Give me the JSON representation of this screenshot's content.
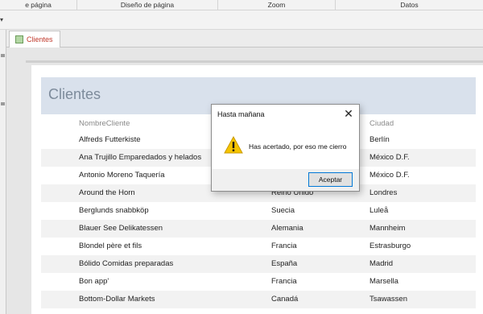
{
  "ribbon": {
    "groups": [
      {
        "label": "e página"
      },
      {
        "label": "Diseño de página"
      },
      {
        "label": "Zoom"
      },
      {
        "label": "Datos"
      }
    ]
  },
  "tabs": {
    "active_label": "Clientes"
  },
  "report": {
    "title": "Clientes",
    "columns": {
      "name": "NombreCliente",
      "city": "Ciudad"
    },
    "rows": [
      {
        "name": "Alfreds Futterkiste",
        "country": "",
        "city": "Berlín"
      },
      {
        "name": "Ana Trujillo Emparedados y helados",
        "country": "",
        "city": "México D.F."
      },
      {
        "name": "Antonio Moreno Taquería",
        "country": "",
        "city": "México D.F."
      },
      {
        "name": "Around the Horn",
        "country": "Reino Unido",
        "city": "Londres"
      },
      {
        "name": "Berglunds snabbköp",
        "country": "Suecia",
        "city": "Luleå"
      },
      {
        "name": "Blauer See Delikatessen",
        "country": "Alemania",
        "city": "Mannheim"
      },
      {
        "name": "Blondel père et fils",
        "country": "Francia",
        "city": "Estrasburgo"
      },
      {
        "name": "Bólido Comidas preparadas",
        "country": "España",
        "city": "Madrid"
      },
      {
        "name": "Bon app'",
        "country": "Francia",
        "city": "Marsella"
      },
      {
        "name": "Bottom-Dollar Markets",
        "country": "Canadá",
        "city": "Tsawassen"
      }
    ]
  },
  "dialog": {
    "title": "Hasta mañana",
    "message": "Has acertado, por eso me cierro",
    "ok_label": "Aceptar",
    "close_glyph": "✕",
    "icon": "warning-icon"
  },
  "colors": {
    "tab_label": "#c0392b",
    "header_band": "#d9e1ec",
    "title_text": "#7d8b9b",
    "ok_border": "#0078d7",
    "warning_fill": "#f5c400"
  }
}
